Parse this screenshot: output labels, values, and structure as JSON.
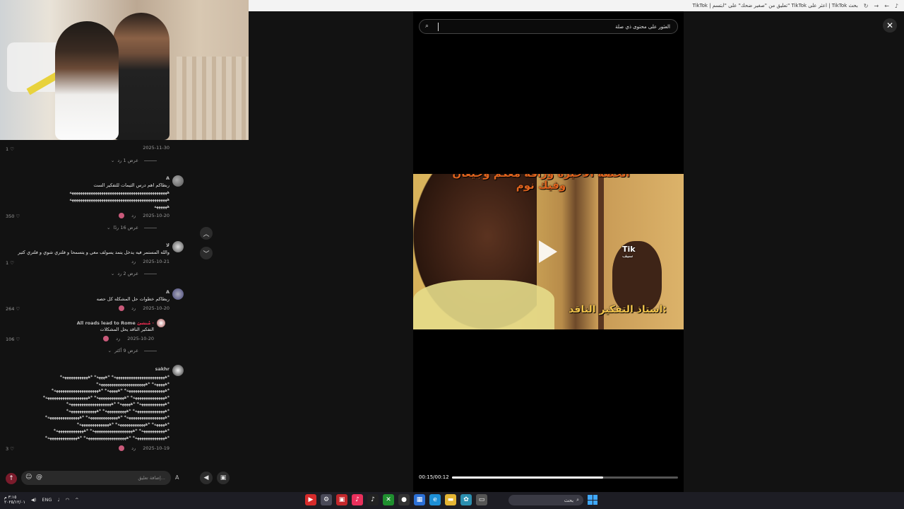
{
  "browser": {
    "tab_title": "TikTok | تعليق من \"صغير ضحك\" على \"ابتسم\" TikTok اعثر على | TikTok بحث",
    "icons": [
      "reload-icon",
      "forward-icon",
      "back-icon",
      "tiktok-icon"
    ]
  },
  "comments": {
    "items": [
      {
        "meta_date": "2025-11-30",
        "likes": "1",
        "view_replies": "عرض 1 رد"
      },
      {
        "username": "A",
        "text_lines": [
          "ربطاكم اهم درس الثيمات للتفكير الست",
          "ههههههههههههههههههههههههههههههههههههههههههههههه",
          "ههههههههههههههههههههههههههههههههههههههههههههههه",
          "ههههههه"
        ],
        "date": "2025-10-20",
        "reply": "رد",
        "likes": "350",
        "view_replies": "عرض 16 ردًا"
      },
      {
        "username": "لا",
        "text_lines": [
          "والله المستمر فيه يدخل يتمد يسولف معي و يتسمحا و فلتري شوي و فلتري كثير"
        ],
        "date": "2025-10-21",
        "reply": "رد",
        "likes": "1",
        "view_replies": "عرض 2 رد"
      },
      {
        "username": "A",
        "text_lines": [
          "ربطاكم خطوات حل المشكله كل حصه"
        ],
        "date": "2025-10-20",
        "reply": "رد",
        "likes": "264"
      },
      {
        "username": "All roads lead to Rome",
        "author_tag": "مُنشئ ·",
        "text_lines": [
          "التفكير الناقد يحل المشكلات"
        ],
        "date": "2025-10-20",
        "reply": "رد",
        "likes": "106",
        "view_replies": "عرض 9 أكثر"
      },
      {
        "username": "sakhr",
        "text_lines": [
          "*ههههههههههههههههههههههههه* *ههههه* *ههههههههههههه*",
          "*هههههه* *ههههههههههههههههههههههه*",
          "*ههههههههههههههههههه* *هههههه* *هههههههههههههههههههههه*",
          "*هههههههههههههههه* *هههههههههههههه* *ههههههههههههههههههههه*",
          "*ههههههههههههه* *هههههه* *ههههههههههههههههههههه*",
          "*ههههههههههههههه* *ههههههههههه* *هههههههههههههه*",
          "*ههههههههههههههههههه* *ههههههههههههههه* *هههههههههههههههه*",
          "*هههههه* *هههههههههههههه* *ههههههههههههههه*",
          "*هههههههههههه* *هههههههههههههههههههه* *هههههههههههههه*",
          "*ههههههههههههههه* *هههههههههههههههههههه* *ههههههههههههههه*"
        ],
        "date": "2025-10-19",
        "reply": "رد",
        "likes": "3"
      }
    ],
    "input_placeholder": "إضافة تعليق..."
  },
  "player": {
    "search_text": "العثور على محتوى ذي صلة",
    "caption_top": "الحصه الاخيرة وزاقه معكم وجيعان وفيك نوم",
    "caption_bottom": "استاذ التفكير الناقد:",
    "watermark": "Tik",
    "watermark_sub": "سيف",
    "time": "00:15/00:12",
    "progress": 0.67
  },
  "taskbar": {
    "clock_time": "٣:١٥ م",
    "clock_date": "٢٠٢٥/١٢/٠١",
    "lang": "ENG",
    "search": "بحث",
    "apps": [
      {
        "name": "youtube-app-icon",
        "glyph": "▶",
        "color": "#d62b2b"
      },
      {
        "name": "settings-app-icon",
        "glyph": "⚙",
        "color": "#4a4a58"
      },
      {
        "name": "news-app-icon",
        "glyph": "▣",
        "color": "#c3272b"
      },
      {
        "name": "tiktok-app-icon",
        "glyph": "♪",
        "color": "#e9305c"
      },
      {
        "name": "tiktok-active-icon",
        "glyph": "♪",
        "color": "#222"
      },
      {
        "name": "xbox-app-icon",
        "glyph": "✕",
        "color": "#1f8f2f"
      },
      {
        "name": "obs-app-icon",
        "glyph": "●",
        "color": "#333"
      },
      {
        "name": "store-app-icon",
        "glyph": "▦",
        "color": "#2b6fd6"
      },
      {
        "name": "edge-app-icon",
        "glyph": "e",
        "color": "#1d8fd6"
      },
      {
        "name": "explorer-app-icon",
        "glyph": "▬",
        "color": "#e5b534"
      },
      {
        "name": "photos-app-icon",
        "glyph": "✿",
        "color": "#2b8fb0"
      },
      {
        "name": "window-app-icon",
        "glyph": "▭",
        "color": "#555"
      }
    ]
  },
  "colors": {
    "accent": "#fe2c55",
    "caption_orange": "#e0641e",
    "caption_gold": "#f0c24a"
  }
}
